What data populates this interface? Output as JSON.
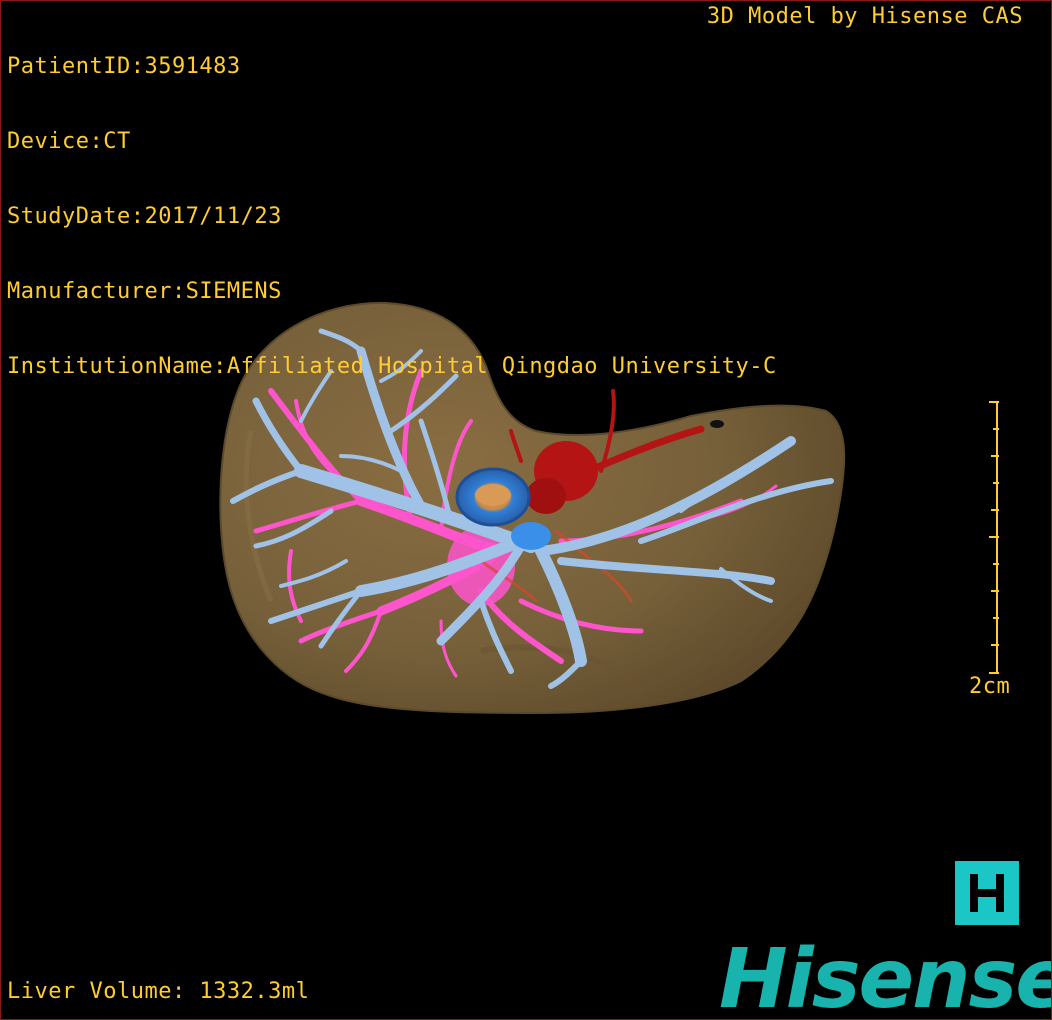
{
  "study_info": {
    "patient_id": "PatientID:3591483",
    "device": "Device:CT",
    "study_date": "StudyDate:2017/11/23",
    "manufacturer": "Manufacturer:SIEMENS",
    "institution": "InstitutionName:Affiliated Hospital Qingdao University-C"
  },
  "brand_credit": "3D Model by Hisense CAS",
  "liver_volume": "Liver Volume: 1332.3ml",
  "scale_bar": {
    "label": "2cm"
  },
  "logo": {
    "letter": "H",
    "wordmark": "Hisense"
  },
  "colors": {
    "overlay_text": "#ffcc33",
    "liver": "#7a6038",
    "hepatic_vein": "#9fc2e6",
    "portal_vein": "#ff55cc",
    "artery": "#c01818",
    "ivc": "#3a8fe8",
    "brand": "#19b3ad",
    "logo_tile": "#1bc6c6"
  },
  "icons": [
    "liver-3d-model",
    "hisense-logo-icon"
  ]
}
